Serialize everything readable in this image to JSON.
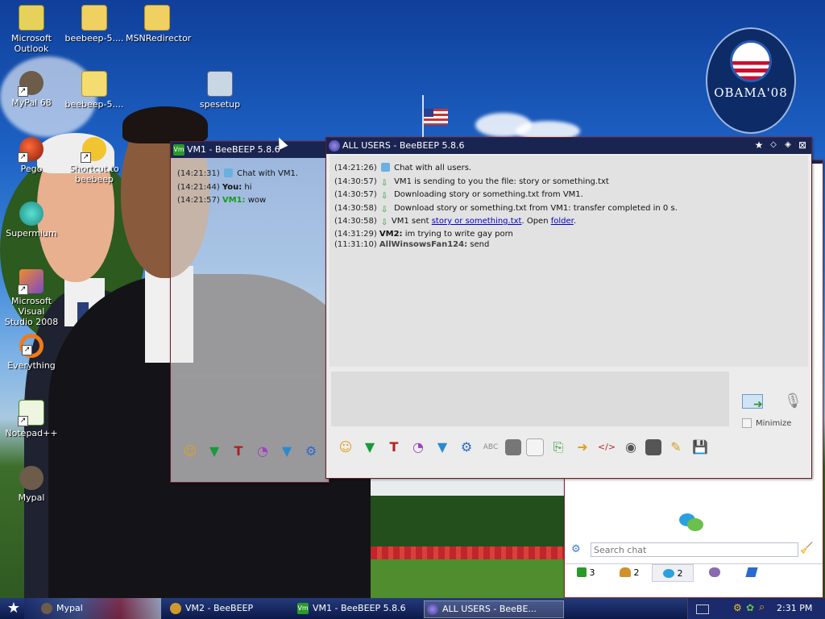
{
  "desktop_icons": [
    {
      "label": "Microsoft\nOutlook"
    },
    {
      "label": "beebeep-5...."
    },
    {
      "label": "MSNRedirector"
    },
    {
      "label": "MyPal 68"
    },
    {
      "label": "beebeep-5...."
    },
    {
      "label": "spesetup"
    },
    {
      "label": "Pego"
    },
    {
      "label": "Shortcut to\nbeebeep"
    },
    {
      "label": "Supermium"
    },
    {
      "label": "Microsoft Visual\nStudio 2008"
    },
    {
      "label": "Everything"
    },
    {
      "label": "Notepad++"
    },
    {
      "label": "Mypal"
    }
  ],
  "wallpaper": {
    "badge_text": "OBAMA'08"
  },
  "vm1_window": {
    "title": "VM1 - BeeBEEP 5.8.6",
    "icon_label": "Vm",
    "messages": [
      {
        "time": "(14:21:31)",
        "sender": "",
        "text": "Chat with VM1."
      },
      {
        "time": "(14:21:44)",
        "sender": "You:",
        "text": "hi"
      },
      {
        "time": "(14:21:57)",
        "sender": "VM1:",
        "text": "wow"
      }
    ]
  },
  "all_users_window": {
    "title": "ALL USERS - BeeBEEP 5.8.6",
    "messages": [
      {
        "time": "(14:21:26)",
        "icon": "chat-bubble",
        "sender": "",
        "text": "Chat with all users."
      },
      {
        "time": "(14:30:57)",
        "icon": "download",
        "sender": "",
        "text": "VM1 is sending to you the file: story or something.txt"
      },
      {
        "time": "(14:30:57)",
        "icon": "download",
        "sender": "",
        "text": "Downloading story or something.txt from VM1."
      },
      {
        "time": "(14:30:58)",
        "icon": "download",
        "sender": "",
        "text": "Download story or something.txt from VM1: transfer completed in 0 s."
      },
      {
        "time": "(14:30:58)",
        "icon": "download",
        "sender": "",
        "text": "VM1 sent ",
        "link1": "story or something.txt",
        "mid": ". Open ",
        "link2": "folder",
        "tail": "."
      },
      {
        "time": "(14:31:29)",
        "icon": "",
        "sender": "VM2:",
        "text": "im trying to write gay porn"
      },
      {
        "time": "(11:31:10)",
        "icon": "",
        "sender": "AllWinsowsFan124:",
        "text": "send"
      }
    ],
    "minimize_label": "Minimize",
    "input_value": ""
  },
  "user_list_panel": {
    "search_placeholder": "Search chat",
    "tabs": [
      {
        "icon": "users-icon",
        "count": "3"
      },
      {
        "icon": "groups-icon",
        "count": "2"
      },
      {
        "icon": "chats-icon",
        "count": "2"
      },
      {
        "icon": "people-icon",
        "count": ""
      },
      {
        "icon": "share-icon",
        "count": ""
      }
    ]
  },
  "taskbar": {
    "start_glyph": "★",
    "tasks": [
      {
        "label": "Mypal"
      },
      {
        "label": "VM2 - BeeBEEP"
      },
      {
        "label": "VM1 - BeeBEEP 5.8.6",
        "icon_label": "Vm"
      },
      {
        "label": "ALL USERS - BeeBE..."
      }
    ],
    "clock": "2:31 PM"
  },
  "colors": {
    "titlebar": "#1a2450",
    "window_border": "#6a1d24",
    "link": "#0000cc"
  }
}
